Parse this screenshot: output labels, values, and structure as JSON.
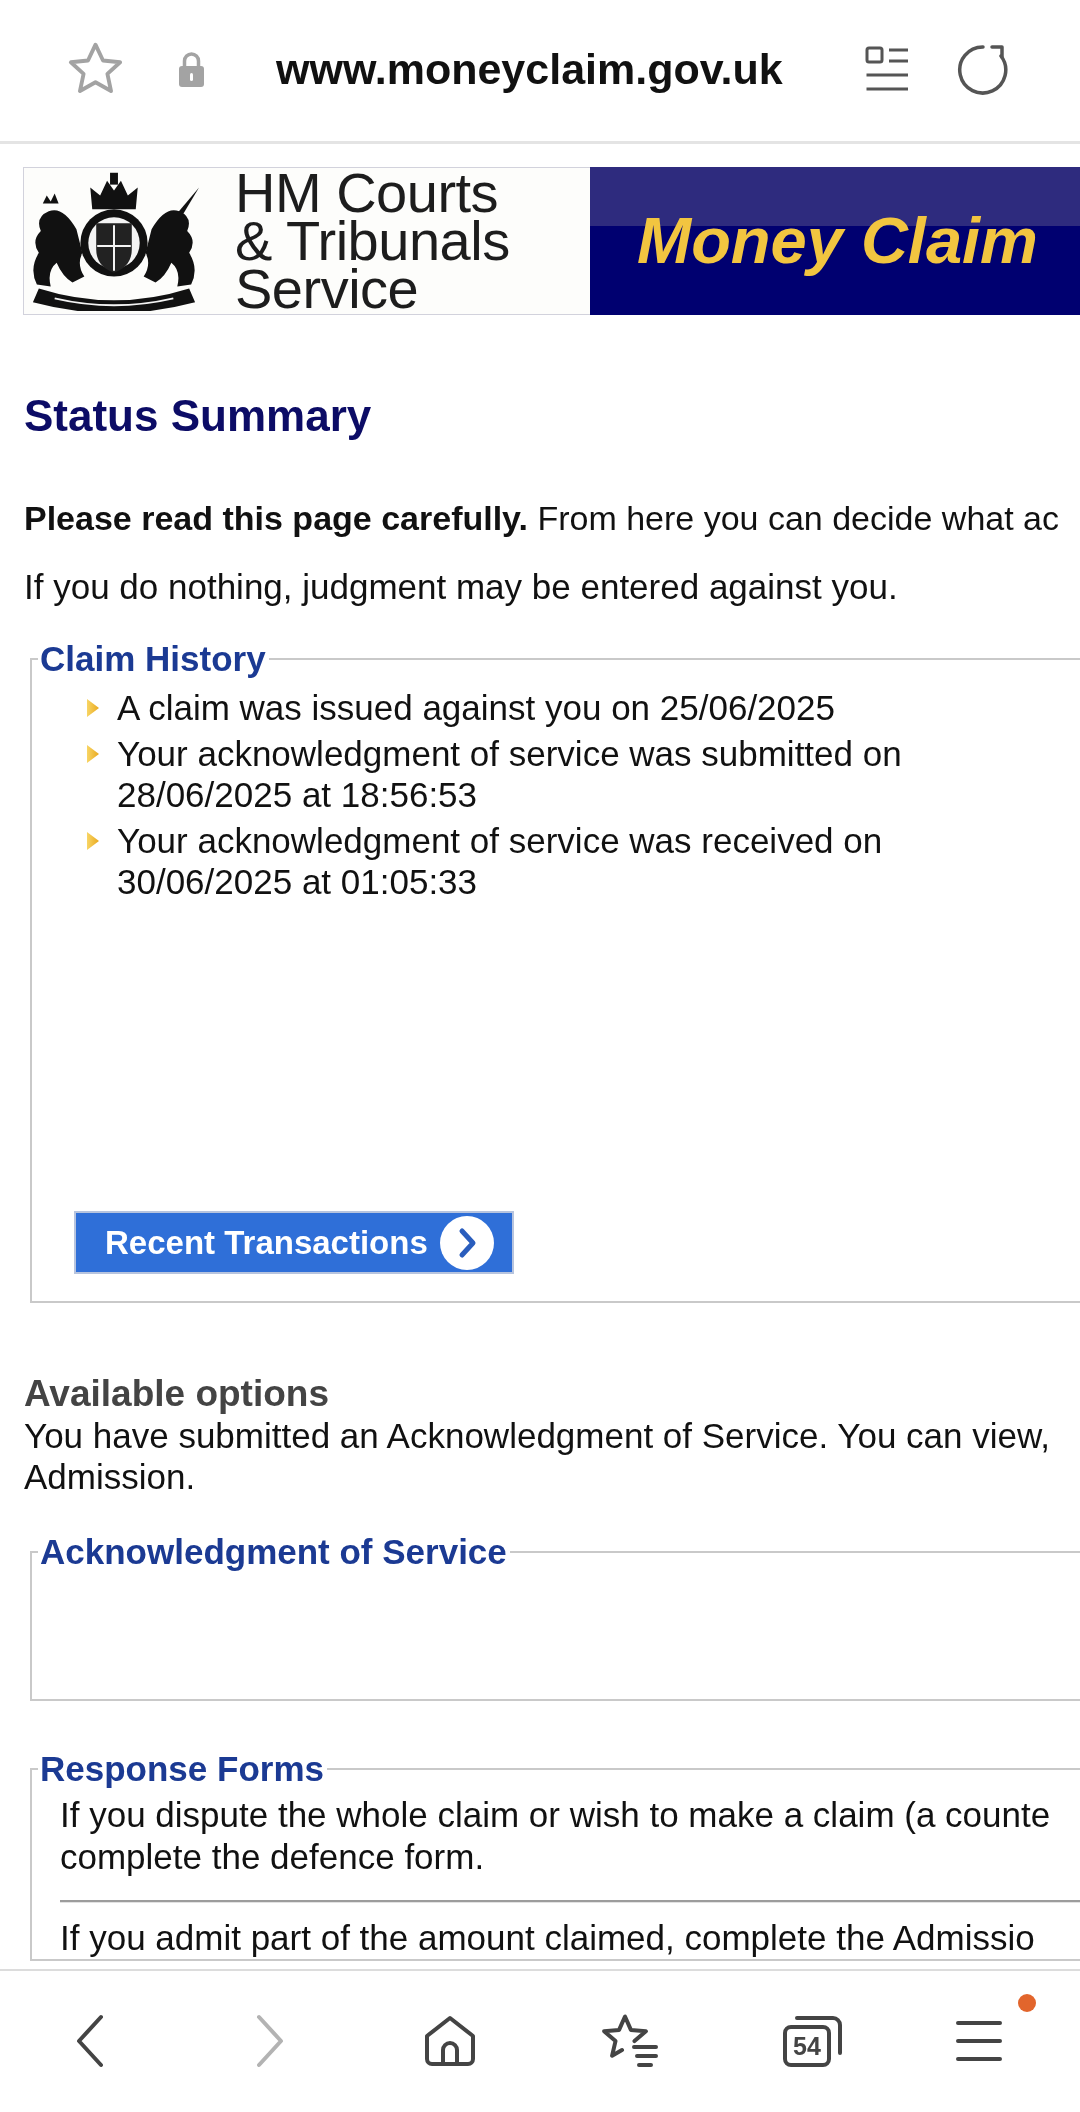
{
  "browser": {
    "url": "www.moneyclaim.gov.uk",
    "bookmarked": false
  },
  "banner": {
    "agency": "HM Courts & Tribunals Service",
    "service": "Money Claim"
  },
  "title": "Status Summary",
  "intro": [
    "**Please read this page carefully.** From here you can decide what ac",
    "If you do nothing, judgment may be entered against you."
  ],
  "claim_history": {
    "legend": "Claim History",
    "events": [
      "A claim was issued against you on 25/06/2025",
      "Your acknowledgment of service was submitted on 28/06/2025 at 18:56:53",
      "Your acknowledgment of service was received on 30/06/2025 at 01:05:33"
    ],
    "button": "Recent Transactions"
  },
  "available_options": {
    "heading": "Available options",
    "lines": [
      "You have submitted an Acknowledgment of Service. You can view,",
      "Admission."
    ]
  },
  "panels": [
    {
      "legend": "Acknowledgment of Service"
    },
    {
      "legend": "Response Forms",
      "blocks": [
        [
          "If you dispute the whole claim or wish to make a claim (a counte",
          "complete the defence form."
        ],
        [
          "If you admit part of the amount claimed, complete the Admissio"
        ]
      ]
    }
  ],
  "nav": [
    {
      "kind": "back",
      "disabled": false
    },
    {
      "kind": "forward",
      "disabled": true
    },
    {
      "kind": "home",
      "disabled": false
    },
    {
      "kind": "bookmarks",
      "disabled": false
    },
    {
      "kind": "tabs",
      "disabled": false,
      "count": "54"
    },
    {
      "kind": "menu",
      "disabled": false,
      "badge": true
    }
  ]
}
